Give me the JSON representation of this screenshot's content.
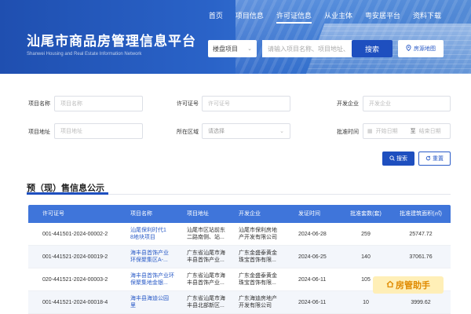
{
  "header": {
    "title": "汕尾市商品房管理信息平台",
    "subtitle": "Shanwei Housing and Real Estate Information Network",
    "nav": [
      "首页",
      "项目信息",
      "许可证信息",
      "从业主体",
      "粤安居平台",
      "资料下载"
    ],
    "active_nav": "许可证信息",
    "search": {
      "select_value": "楼盘项目",
      "placeholder": "请输入项目名称、项目地址、开发企业",
      "button": "搜索"
    },
    "map_button": "房源地图"
  },
  "filters": {
    "project_name": {
      "label": "项目名称",
      "placeholder": "项目名称"
    },
    "license_no": {
      "label": "许可证号",
      "placeholder": "许可证号"
    },
    "developer": {
      "label": "开发企业",
      "placeholder": "开发企业"
    },
    "project_address": {
      "label": "项目地址",
      "placeholder": "项目地址"
    },
    "region": {
      "label": "所在区域",
      "placeholder": "请选择"
    },
    "approval_time": {
      "label": "批准时间",
      "start_placeholder": "开始日期",
      "separator": "至",
      "end_placeholder": "结束日期"
    },
    "query_button": "搜索",
    "reset_button": "重置"
  },
  "section": {
    "title": "预（现）售信息公示"
  },
  "table": {
    "columns": [
      "许可证号",
      "项目名称",
      "项目地址",
      "开发企业",
      "发证时间",
      "批准套数(套)",
      "批准建筑面积(㎡)"
    ],
    "rows": [
      {
        "license": "001-441501-2024-00002-2",
        "project": "汕尾保利时代1\n8地块项目",
        "address": "汕尾市区站前东\n二路南侧、站...",
        "developer": "汕尾市保利房地\n产开发有限公司",
        "date": "2024-06-28",
        "units": "259",
        "area": "25747.72"
      },
      {
        "license": "001-441521-2024-00019-2",
        "project": "海丰县首饰产业\n环保聚集区A-...",
        "address": "广东省汕尾市海\n丰县首饰产业...",
        "developer": "广东金盛泰黄金\n珠宝首饰有限...",
        "date": "2024-06-25",
        "units": "140",
        "area": "37061.76"
      },
      {
        "license": "020-441521-2024-00003-2",
        "project": "海丰县首饰产业环\n保聚集地金银...",
        "address": "广东省汕尾市海\n丰县首饰产业...",
        "developer": "广东金盛泰黄金\n珠宝首饰有限...",
        "date": "2024-06-11",
        "units": "105",
        "area": ""
      },
      {
        "license": "001-441521-2024-00018-4",
        "project": "海丰县海迪公园\n里",
        "address": "广东省汕尾市海\n丰县北部新区...",
        "developer": "广东海迪房地产\n开发有限公司",
        "date": "2024-06-11",
        "units": "10",
        "area": "3999.62"
      }
    ]
  },
  "watermark": "房管助手"
}
